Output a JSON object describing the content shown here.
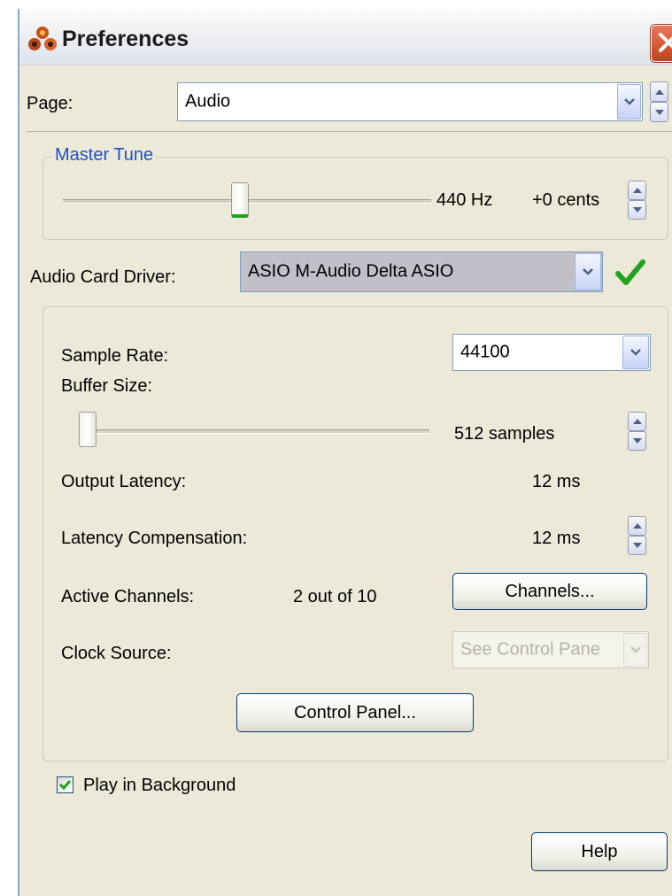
{
  "window": {
    "title": "Preferences",
    "app_icon": "app-logo-icon",
    "close_icon": "close-icon"
  },
  "page_selector": {
    "label": "Page:",
    "value": "Audio"
  },
  "master_tune": {
    "legend": "Master Tune",
    "frequency": "440 Hz",
    "cents": "+0 cents",
    "slider_fraction": 0.48
  },
  "audio_card": {
    "label": "Audio Card Driver:",
    "value": "ASIO M-Audio Delta ASIO",
    "status_icon": "green-checkmark-icon"
  },
  "settings": {
    "sample_rate_label": "Sample Rate:",
    "sample_rate_value": "44100",
    "buffer_size_label": "Buffer Size:",
    "buffer_size_value": "512 samples",
    "buffer_slider_fraction": 0.0,
    "output_latency_label": "Output Latency:",
    "output_latency_value": "12 ms",
    "latency_comp_label": "Latency Compensation:",
    "latency_comp_value": "12 ms",
    "active_channels_label": "Active Channels:",
    "active_channels_value": "2 out of 10",
    "channels_button": "Channels...",
    "clock_source_label": "Clock Source:",
    "clock_source_value": "See Control Pane",
    "control_panel_button": "Control Panel..."
  },
  "play_in_background": {
    "label": "Play in Background",
    "checked": true
  },
  "help_button": "Help",
  "colors": {
    "dialog_bg": "#ece9d8",
    "group_title": "#1e50c8",
    "check_green": "#21a121"
  }
}
